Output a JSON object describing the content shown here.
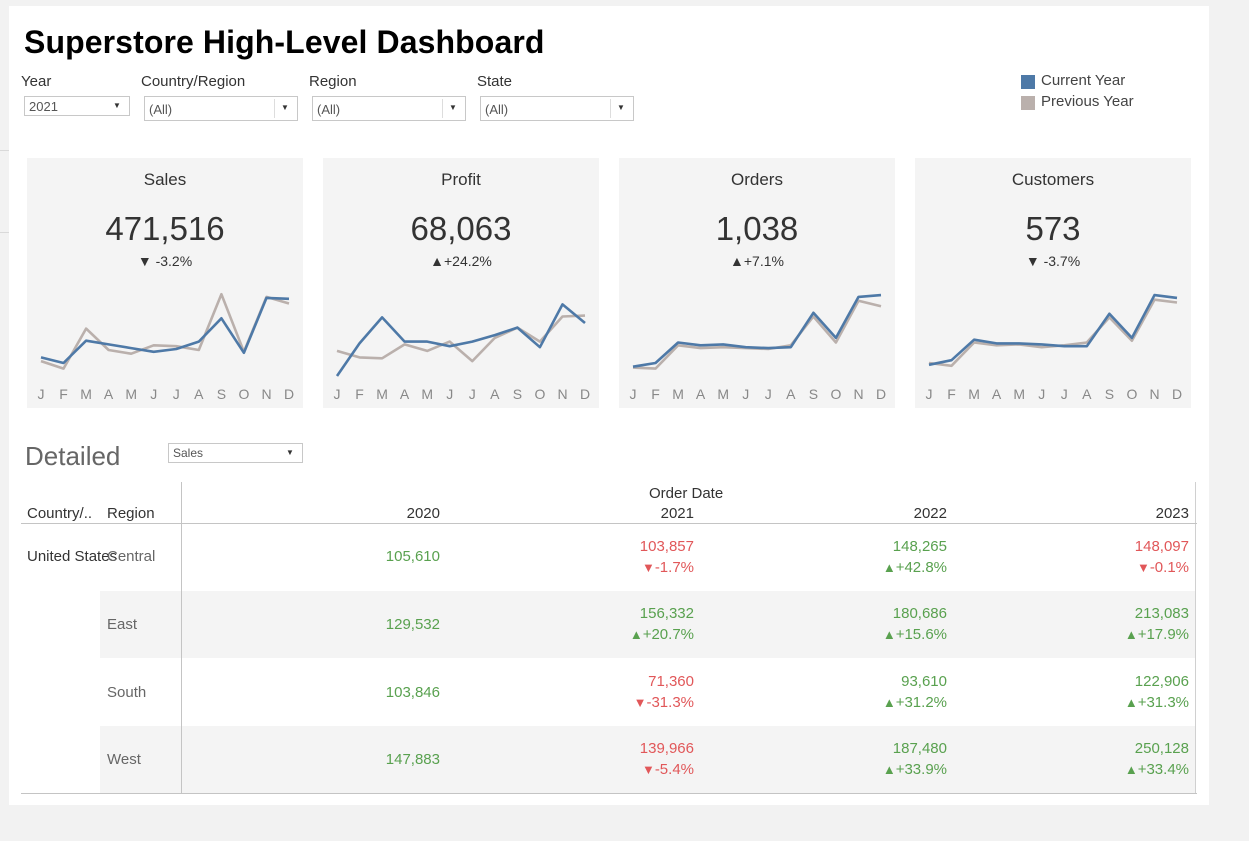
{
  "title": "Superstore High-Level Dashboard",
  "colors": {
    "current": "#4e79a7",
    "previous": "#bab0ac",
    "positive": "#59a14f",
    "negative": "#e15759",
    "card_bg": "#f4f4f4"
  },
  "filters": [
    {
      "label": "Year",
      "value": "2021"
    },
    {
      "label": "Country/Region",
      "value": "(All)"
    },
    {
      "label": "Region",
      "value": "(All)"
    },
    {
      "label": "State",
      "value": "(All)"
    }
  ],
  "legend": [
    {
      "label": "Current Year",
      "color": "#4e79a7"
    },
    {
      "label": "Previous Year",
      "color": "#bab0ac"
    }
  ],
  "month_labels": [
    "J",
    "F",
    "M",
    "A",
    "M",
    "J",
    "J",
    "A",
    "S",
    "O",
    "N",
    "D"
  ],
  "kpis": [
    {
      "title": "Sales",
      "value": "471,516",
      "delta": "-3.2%",
      "direction": "down"
    },
    {
      "title": "Profit",
      "value": "68,063",
      "delta": "+24.2%",
      "direction": "up"
    },
    {
      "title": "Orders",
      "value": "1,038",
      "delta": "+7.1%",
      "direction": "up"
    },
    {
      "title": "Customers",
      "value": "573",
      "delta": "-3.7%",
      "direction": "down"
    }
  ],
  "chart_data": [
    {
      "type": "line",
      "title": "Sales",
      "x": [
        "J",
        "F",
        "M",
        "A",
        "M",
        "J",
        "J",
        "A",
        "S",
        "O",
        "N",
        "D"
      ],
      "series": [
        {
          "name": "Current Year",
          "values": [
            0.2,
            0.14,
            0.38,
            0.34,
            0.3,
            0.26,
            0.29,
            0.37,
            0.62,
            0.25,
            0.84,
            0.83
          ]
        },
        {
          "name": "Previous Year",
          "values": [
            0.16,
            0.08,
            0.51,
            0.28,
            0.24,
            0.33,
            0.32,
            0.28,
            0.88,
            0.26,
            0.85,
            0.78
          ]
        }
      ]
    },
    {
      "type": "line",
      "title": "Profit",
      "x": [
        "J",
        "F",
        "M",
        "A",
        "M",
        "J",
        "J",
        "A",
        "S",
        "O",
        "N",
        "D"
      ],
      "series": [
        {
          "name": "Current Year",
          "values": [
            0.0,
            0.35,
            0.63,
            0.37,
            0.37,
            0.32,
            0.37,
            0.44,
            0.52,
            0.31,
            0.77,
            0.57
          ]
        },
        {
          "name": "Previous Year",
          "values": [
            0.27,
            0.2,
            0.19,
            0.34,
            0.27,
            0.37,
            0.16,
            0.41,
            0.52,
            0.37,
            0.64,
            0.65
          ]
        }
      ]
    },
    {
      "type": "line",
      "title": "Orders",
      "x": [
        "J",
        "F",
        "M",
        "A",
        "M",
        "J",
        "J",
        "A",
        "S",
        "O",
        "N",
        "D"
      ],
      "series": [
        {
          "name": "Current Year",
          "values": [
            0.1,
            0.14,
            0.36,
            0.33,
            0.34,
            0.31,
            0.3,
            0.31,
            0.68,
            0.41,
            0.85,
            0.87
          ]
        },
        {
          "name": "Previous Year",
          "values": [
            0.09,
            0.08,
            0.33,
            0.3,
            0.31,
            0.3,
            0.29,
            0.33,
            0.64,
            0.36,
            0.81,
            0.75
          ]
        }
      ]
    },
    {
      "type": "line",
      "title": "Customers",
      "x": [
        "J",
        "F",
        "M",
        "A",
        "M",
        "J",
        "J",
        "A",
        "S",
        "O",
        "N",
        "D"
      ],
      "series": [
        {
          "name": "Current Year",
          "values": [
            0.12,
            0.17,
            0.39,
            0.35,
            0.35,
            0.34,
            0.32,
            0.32,
            0.67,
            0.41,
            0.87,
            0.84
          ]
        },
        {
          "name": "Previous Year",
          "values": [
            0.14,
            0.11,
            0.36,
            0.33,
            0.34,
            0.31,
            0.33,
            0.36,
            0.63,
            0.38,
            0.82,
            0.79
          ]
        }
      ]
    }
  ],
  "detailed": {
    "heading": "Detailed",
    "measure": "Sales",
    "order_date_label": "Order Date",
    "col_country": "Country/..",
    "col_region": "Region",
    "years": [
      "2020",
      "2021",
      "2022",
      "2023"
    ],
    "country": "United States",
    "rows": [
      {
        "region": "Central",
        "cells": [
          {
            "value": "105,610",
            "pct": "",
            "dir": "none"
          },
          {
            "value": "103,857",
            "pct": "-1.7%",
            "dir": "down"
          },
          {
            "value": "148,265",
            "pct": "+42.8%",
            "dir": "up"
          },
          {
            "value": "148,097",
            "pct": "-0.1%",
            "dir": "down"
          }
        ]
      },
      {
        "region": "East",
        "cells": [
          {
            "value": "129,532",
            "pct": "",
            "dir": "none"
          },
          {
            "value": "156,332",
            "pct": "+20.7%",
            "dir": "up"
          },
          {
            "value": "180,686",
            "pct": "+15.6%",
            "dir": "up"
          },
          {
            "value": "213,083",
            "pct": "+17.9%",
            "dir": "up"
          }
        ]
      },
      {
        "region": "South",
        "cells": [
          {
            "value": "103,846",
            "pct": "",
            "dir": "none"
          },
          {
            "value": "71,360",
            "pct": "-31.3%",
            "dir": "down"
          },
          {
            "value": "93,610",
            "pct": "+31.2%",
            "dir": "up"
          },
          {
            "value": "122,906",
            "pct": "+31.3%",
            "dir": "up"
          }
        ]
      },
      {
        "region": "West",
        "cells": [
          {
            "value": "147,883",
            "pct": "",
            "dir": "none"
          },
          {
            "value": "139,966",
            "pct": "-5.4%",
            "dir": "down"
          },
          {
            "value": "187,480",
            "pct": "+33.9%",
            "dir": "up"
          },
          {
            "value": "250,128",
            "pct": "+33.4%",
            "dir": "up"
          }
        ]
      }
    ]
  }
}
